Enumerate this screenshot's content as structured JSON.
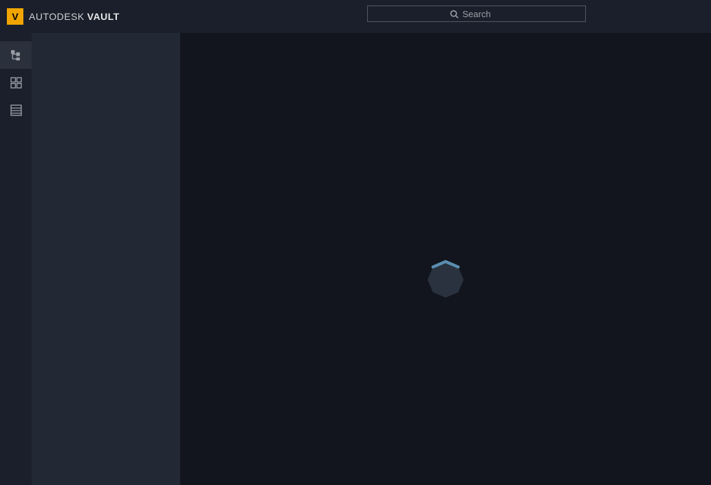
{
  "header": {
    "logo_letter": "V",
    "brand_part1": "AUTODESK",
    "brand_separator": "®",
    "brand_part2": "VAULT",
    "search_placeholder": "Search"
  },
  "sidebar": {
    "items": [
      {
        "name": "tree-view",
        "active": true
      },
      {
        "name": "grid-view",
        "active": false
      },
      {
        "name": "list-view",
        "active": false
      }
    ]
  },
  "main": {
    "state": "loading"
  }
}
